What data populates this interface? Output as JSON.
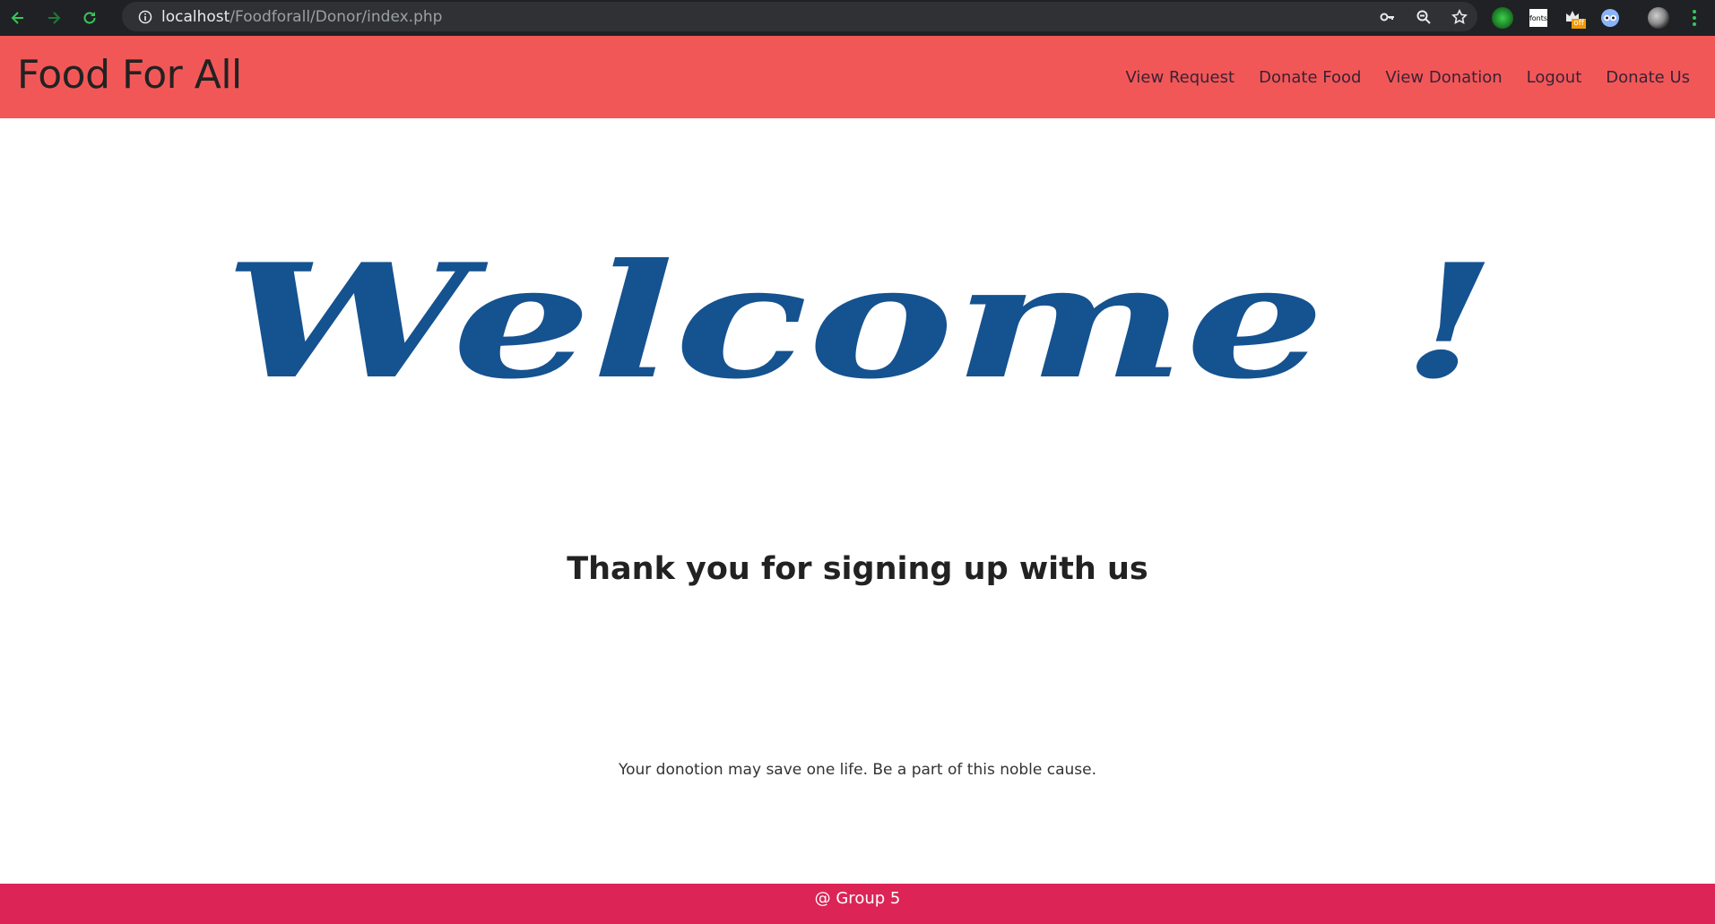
{
  "browser": {
    "url_host": "localhost",
    "url_path": "/Foodforall/Donor/index.php",
    "extensions": {
      "fonts_label": "fonts",
      "off_badge": "off"
    }
  },
  "site": {
    "brand": "Food For All",
    "nav": [
      {
        "label": "View Request"
      },
      {
        "label": "Donate Food"
      },
      {
        "label": "View Donation"
      },
      {
        "label": "Logout"
      },
      {
        "label": "Donate Us"
      }
    ],
    "header_color": "#f25757"
  },
  "main": {
    "welcome_text": "Welcome !",
    "welcome_color": "#155290",
    "thanks_heading": "Thank you for signing up with us",
    "tagline": "Your donotion may save one life. Be a part of this noble cause."
  },
  "footer": {
    "text": "@ Group 5",
    "color": "#dc2456"
  }
}
